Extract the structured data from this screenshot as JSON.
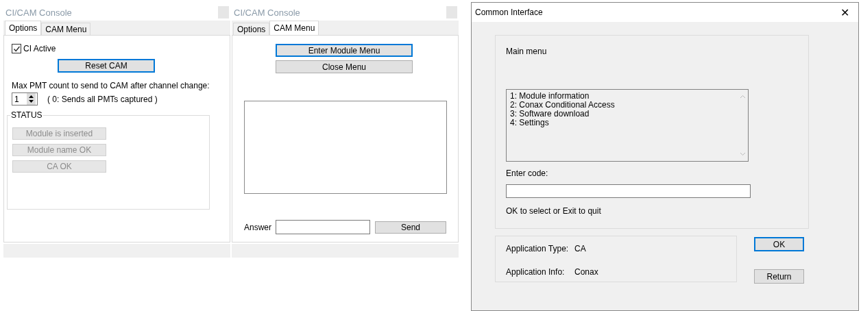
{
  "consoles": [
    {
      "title": "CI/CAM Console",
      "kind": "options",
      "tabs": [
        {
          "label": "Options",
          "selected": true
        },
        {
          "label": "CAM Menu",
          "selected": false
        }
      ],
      "ci_active": {
        "label": "CI Active",
        "checked": true
      },
      "reset_button": {
        "label": "Reset CAM",
        "focused": true
      },
      "pmt_label": "Max PMT count to send to CAM after channel change:",
      "pmt_value": "1",
      "pmt_hint": "( 0: Sends all PMTs captured )",
      "status": {
        "title": "STATUS",
        "items": [
          {
            "label": "Module is inserted",
            "disabled": true
          },
          {
            "label": "Module name OK",
            "disabled": true
          },
          {
            "label": "CA OK",
            "disabled": true
          }
        ]
      }
    },
    {
      "title": "CI/CAM Console",
      "kind": "cam_menu",
      "tabs": [
        {
          "label": "Options",
          "selected": false
        },
        {
          "label": "CAM Menu",
          "selected": true
        }
      ],
      "enter_button": {
        "label": "Enter Module Menu",
        "focused": true
      },
      "close_button": {
        "label": "Close Menu",
        "focused": false
      },
      "answer_label": "Answer",
      "send_button": {
        "label": "Send",
        "focused": false
      }
    }
  ],
  "dialog": {
    "title": "Common Interface",
    "close_glyph": "✕",
    "main_menu": "Main menu",
    "menu_items": [
      "1: Module information",
      "2: Conax Conditional Access",
      "3: Software download",
      "4: Settings"
    ],
    "code_label": "Enter code:",
    "hint": "OK to select or Exit to quit",
    "app_type_label": "Application Type:",
    "app_type_value": "CA",
    "app_info_label": "Application Info:",
    "app_info_value": "Conax",
    "ok_button": {
      "label": "OK",
      "focused": true
    },
    "return_button": {
      "label": "Return",
      "focused": false
    }
  }
}
